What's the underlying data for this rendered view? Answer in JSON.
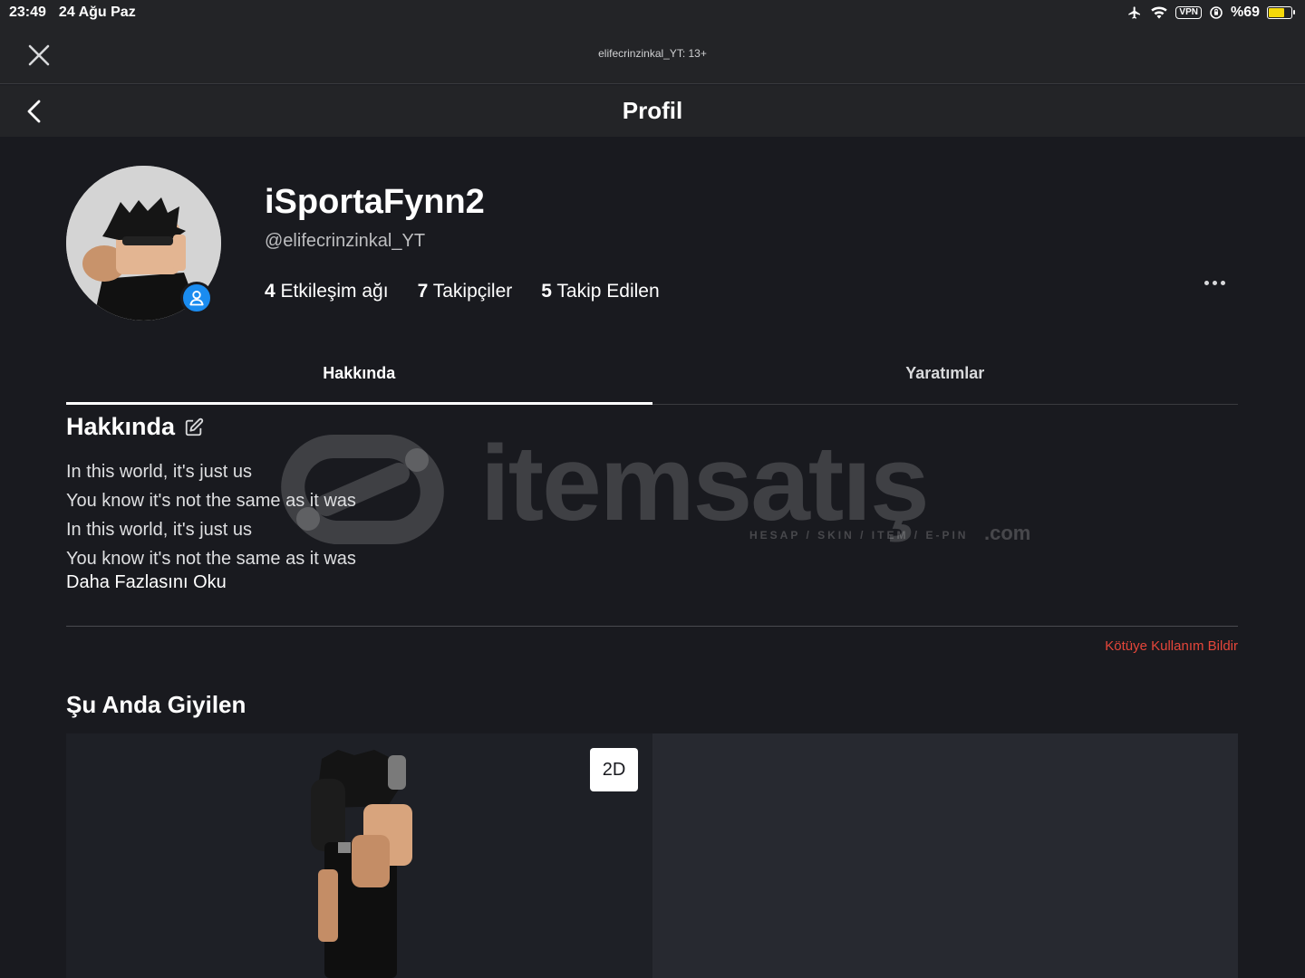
{
  "status_bar": {
    "time": "23:49",
    "date": "24 Ağu Paz",
    "vpn": "VPN",
    "battery": "%69",
    "battery_level": 0.69
  },
  "topbar": {
    "title": "elifecrinzinkal_YT: 13+",
    "close_icon": "close-icon"
  },
  "header": {
    "title": "Profil",
    "back_icon": "chevron-left-icon"
  },
  "profile": {
    "display_name": "iSportaFynn2",
    "username": "@elifecrinzinkal_YT",
    "stats": [
      {
        "count": "4",
        "label": "Etkileşim ağı"
      },
      {
        "count": "7",
        "label": "Takipçiler"
      },
      {
        "count": "5",
        "label": "Takip Edilen"
      }
    ],
    "presence_color": "#1a8cf0"
  },
  "tabs": [
    {
      "label": "Hakkında",
      "active": true
    },
    {
      "label": "Yaratımlar",
      "active": false
    }
  ],
  "about": {
    "heading": "Hakkında",
    "bio_lines": [
      "In this world, it's just us",
      "You know it's not the same as it was",
      "In this world, it's just us",
      "You know it's not the same as it was"
    ],
    "read_more": "Daha Fazlasını Oku",
    "report": "Kötüye Kullanım Bildir"
  },
  "watermark": {
    "brand": "itemsatış",
    "tagline": "HESAP / SKIN / ITEM / E-PIN",
    "domain": ".com"
  },
  "wearing": {
    "heading": "Şu Anda Giyilen",
    "view_toggle": "2D"
  },
  "colors": {
    "background": "#191a1f",
    "bar": "#232427",
    "report": "#e5463a"
  }
}
